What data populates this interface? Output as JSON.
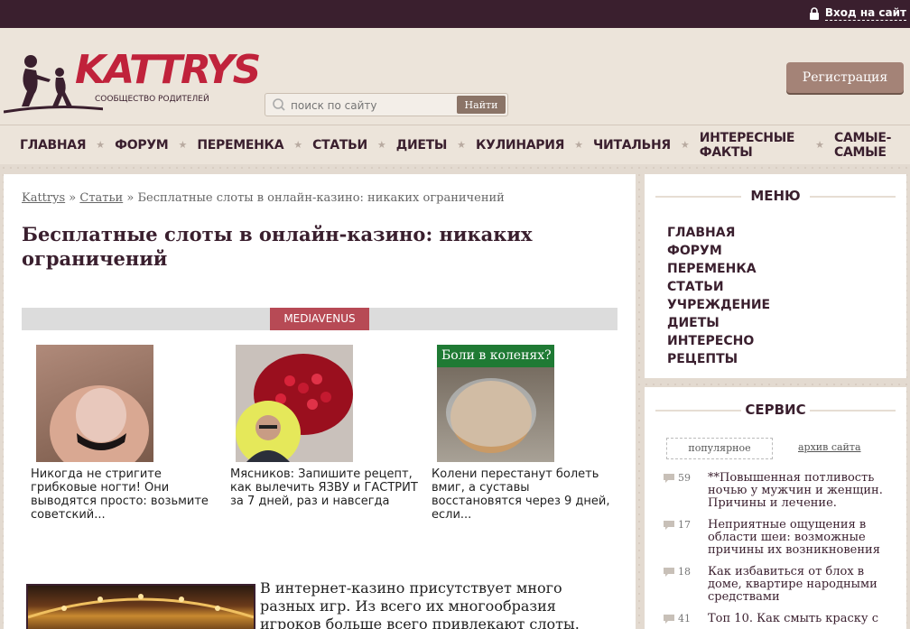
{
  "topbar": {
    "login_label": "Вход на сайт"
  },
  "header": {
    "logo_text": "KATTRYS",
    "logo_tagline": "СООБЩЕСТВО РОДИТЕЛЕЙ",
    "search_placeholder": "поиск по сайту",
    "search_button": "Найти",
    "register_button": "Регистрация"
  },
  "nav": {
    "items": [
      "ГЛАВНАЯ",
      "ФОРУМ",
      "ПЕРЕМЕНКА",
      "СТАТЬИ",
      "ДИЕТЫ",
      "КУЛИНАРИЯ",
      "ЧИТАЛЬНЯ",
      "ИНТЕРЕСНЫЕ ФАКТЫ",
      "САМЫЕ-САМЫЕ"
    ]
  },
  "breadcrumb": {
    "home": "Kattrys",
    "section": "Статьи",
    "sep": "»",
    "current": "Бесплатные слоты в онлайн-казино: никаких ограничений"
  },
  "article": {
    "title": "Бесплатные слоты в онлайн-казино: никаких ограничений",
    "intro": "В интернет-казино присутствует много разных игр. Из всего их многообразия игроков больше всего привлекают слоты."
  },
  "ads": {
    "label": "MEDIAVENUS",
    "items": [
      {
        "caption": "Никогда не стригите грибковые ногти! Они выводятся просто: возьмите советский..."
      },
      {
        "caption": "Мясников: Запишите рецепт, как вылечить ЯЗВУ и ГАСТРИТ за 7 дней, раз и навсегда"
      },
      {
        "caption": "Колени перестанут болеть вмиг, а суставы восстановятся через 9 дней, если...",
        "overlay": "Боли в коленях?"
      }
    ]
  },
  "sidebar": {
    "menu_title": "МЕНЮ",
    "menu_items": [
      "ГЛАВНАЯ",
      "ФОРУМ",
      "ПЕРЕМЕНКА",
      "СТАТЬИ",
      "УЧРЕЖДЕНИЕ",
      "ДИЕТЫ",
      "ИНТЕРЕСНО",
      "РЕЦЕПТЫ"
    ],
    "service_title": "СЕРВИС",
    "tab_popular": "популярное",
    "tab_archive": "архив сайта",
    "popular": [
      {
        "count": "59",
        "title": "**Повышенная потливость ночью у мужчин и женщин. Причины и лечение."
      },
      {
        "count": "17",
        "title": "Неприятные ощущения в области шеи: возможные причины их возникновения"
      },
      {
        "count": "18",
        "title": "Как избавиться от блох в доме, квартире народными средствами"
      },
      {
        "count": "41",
        "title": "Топ 10. Как смыть краску с"
      }
    ]
  },
  "colors": {
    "brand_red": "#c0223b",
    "dark_plum": "#3a1f2e",
    "ad_label": "#b74a55"
  }
}
